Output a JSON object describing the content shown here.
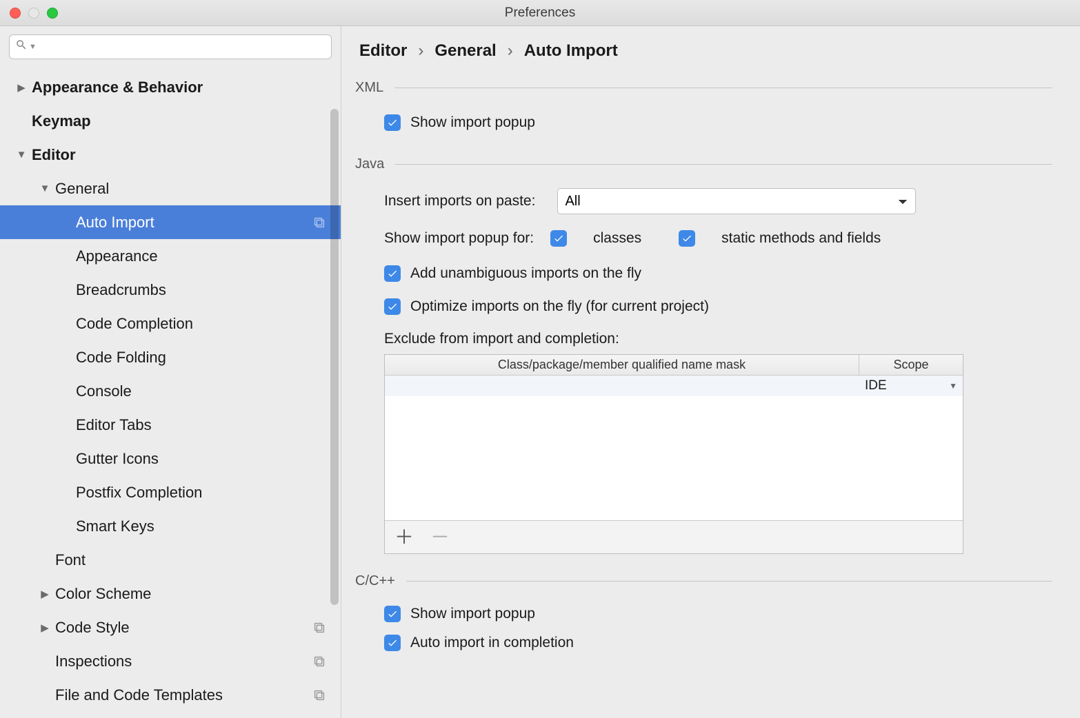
{
  "window": {
    "title": "Preferences"
  },
  "breadcrumb": {
    "a": "Editor",
    "b": "General",
    "c": "Auto Import"
  },
  "sidebar": {
    "items": [
      {
        "label": "Appearance & Behavior",
        "bold": true,
        "arrow": "right",
        "ind": 0
      },
      {
        "label": "Keymap",
        "bold": true,
        "arrow": "",
        "ind": 0
      },
      {
        "label": "Editor",
        "bold": true,
        "arrow": "down",
        "ind": 0
      },
      {
        "label": "General",
        "bold": false,
        "arrow": "down",
        "ind": 1
      },
      {
        "label": "Auto Import",
        "bold": false,
        "arrow": "",
        "ind": 2,
        "copy": true,
        "selected": true
      },
      {
        "label": "Appearance",
        "bold": false,
        "arrow": "",
        "ind": 2
      },
      {
        "label": "Breadcrumbs",
        "bold": false,
        "arrow": "",
        "ind": 2
      },
      {
        "label": "Code Completion",
        "bold": false,
        "arrow": "",
        "ind": 2
      },
      {
        "label": "Code Folding",
        "bold": false,
        "arrow": "",
        "ind": 2
      },
      {
        "label": "Console",
        "bold": false,
        "arrow": "",
        "ind": 2
      },
      {
        "label": "Editor Tabs",
        "bold": false,
        "arrow": "",
        "ind": 2
      },
      {
        "label": "Gutter Icons",
        "bold": false,
        "arrow": "",
        "ind": 2
      },
      {
        "label": "Postfix Completion",
        "bold": false,
        "arrow": "",
        "ind": 2
      },
      {
        "label": "Smart Keys",
        "bold": false,
        "arrow": "",
        "ind": 2
      },
      {
        "label": "Font",
        "bold": false,
        "arrow": "",
        "ind": 1
      },
      {
        "label": "Color Scheme",
        "bold": false,
        "arrow": "right",
        "ind": 1
      },
      {
        "label": "Code Style",
        "bold": false,
        "arrow": "right",
        "ind": 1,
        "copy": true
      },
      {
        "label": "Inspections",
        "bold": false,
        "arrow": "",
        "ind": 1,
        "copy": true
      },
      {
        "label": "File and Code Templates",
        "bold": false,
        "arrow": "",
        "ind": 1,
        "copy": true
      }
    ]
  },
  "sections": {
    "xml": {
      "title": "XML",
      "show_popup": "Show import popup"
    },
    "java": {
      "title": "Java",
      "insert_label": "Insert imports on paste:",
      "insert_value": "All",
      "show_popup_for": "Show import popup for:",
      "classes": "classes",
      "static": "static methods and fields",
      "unambiguous": "Add unambiguous imports on the fly",
      "optimize": "Optimize imports on the fly (for current project)",
      "exclude": "Exclude from import and completion:",
      "col1": "Class/package/member qualified name mask",
      "col2": "Scope",
      "row_scope": "IDE"
    },
    "cpp": {
      "title": "C/C++",
      "show_popup": "Show import popup",
      "auto_import": "Auto import in completion"
    }
  },
  "search": {
    "placeholder": ""
  }
}
